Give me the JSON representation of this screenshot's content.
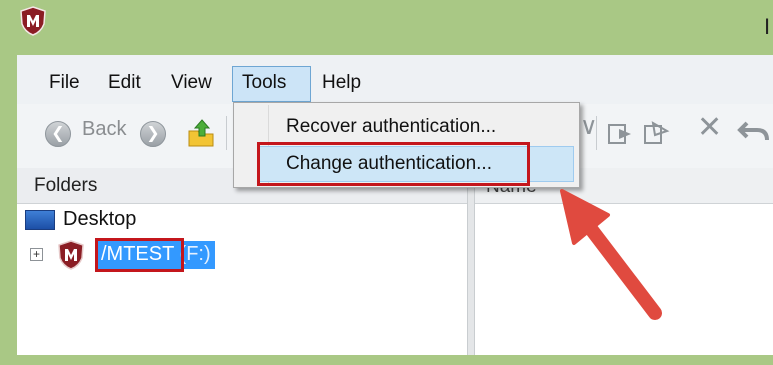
{
  "window": {
    "title_fragment": "I",
    "frame_color": "#a9c885"
  },
  "menu": {
    "file": "File",
    "edit": "Edit",
    "view": "View",
    "tools": "Tools",
    "help": "Help"
  },
  "toolbar": {
    "back_label": "Back"
  },
  "tools_menu": {
    "items": [
      {
        "label": "Recover authentication..."
      },
      {
        "label": "Change authentication..."
      }
    ]
  },
  "folders": {
    "header": "Folders",
    "desktop": "Desktop",
    "drive_name": "/MTEST",
    "drive_letter": "(F:)"
  },
  "files": {
    "column_name": "Name"
  },
  "colors": {
    "highlight_red": "#c4161c",
    "selection_blue": "#3399ff",
    "arrow_red": "#e04a3f",
    "menu_hover": "#cde6f7"
  },
  "icons": [
    "app-shield-icon",
    "back-arrow-icon",
    "forward-arrow-icon",
    "up-folder-icon",
    "drive-shield-icon",
    "desktop-icon",
    "expand-plus-icon",
    "delete-x-icon",
    "undo-icon",
    "pointer-arrow-icon"
  ]
}
